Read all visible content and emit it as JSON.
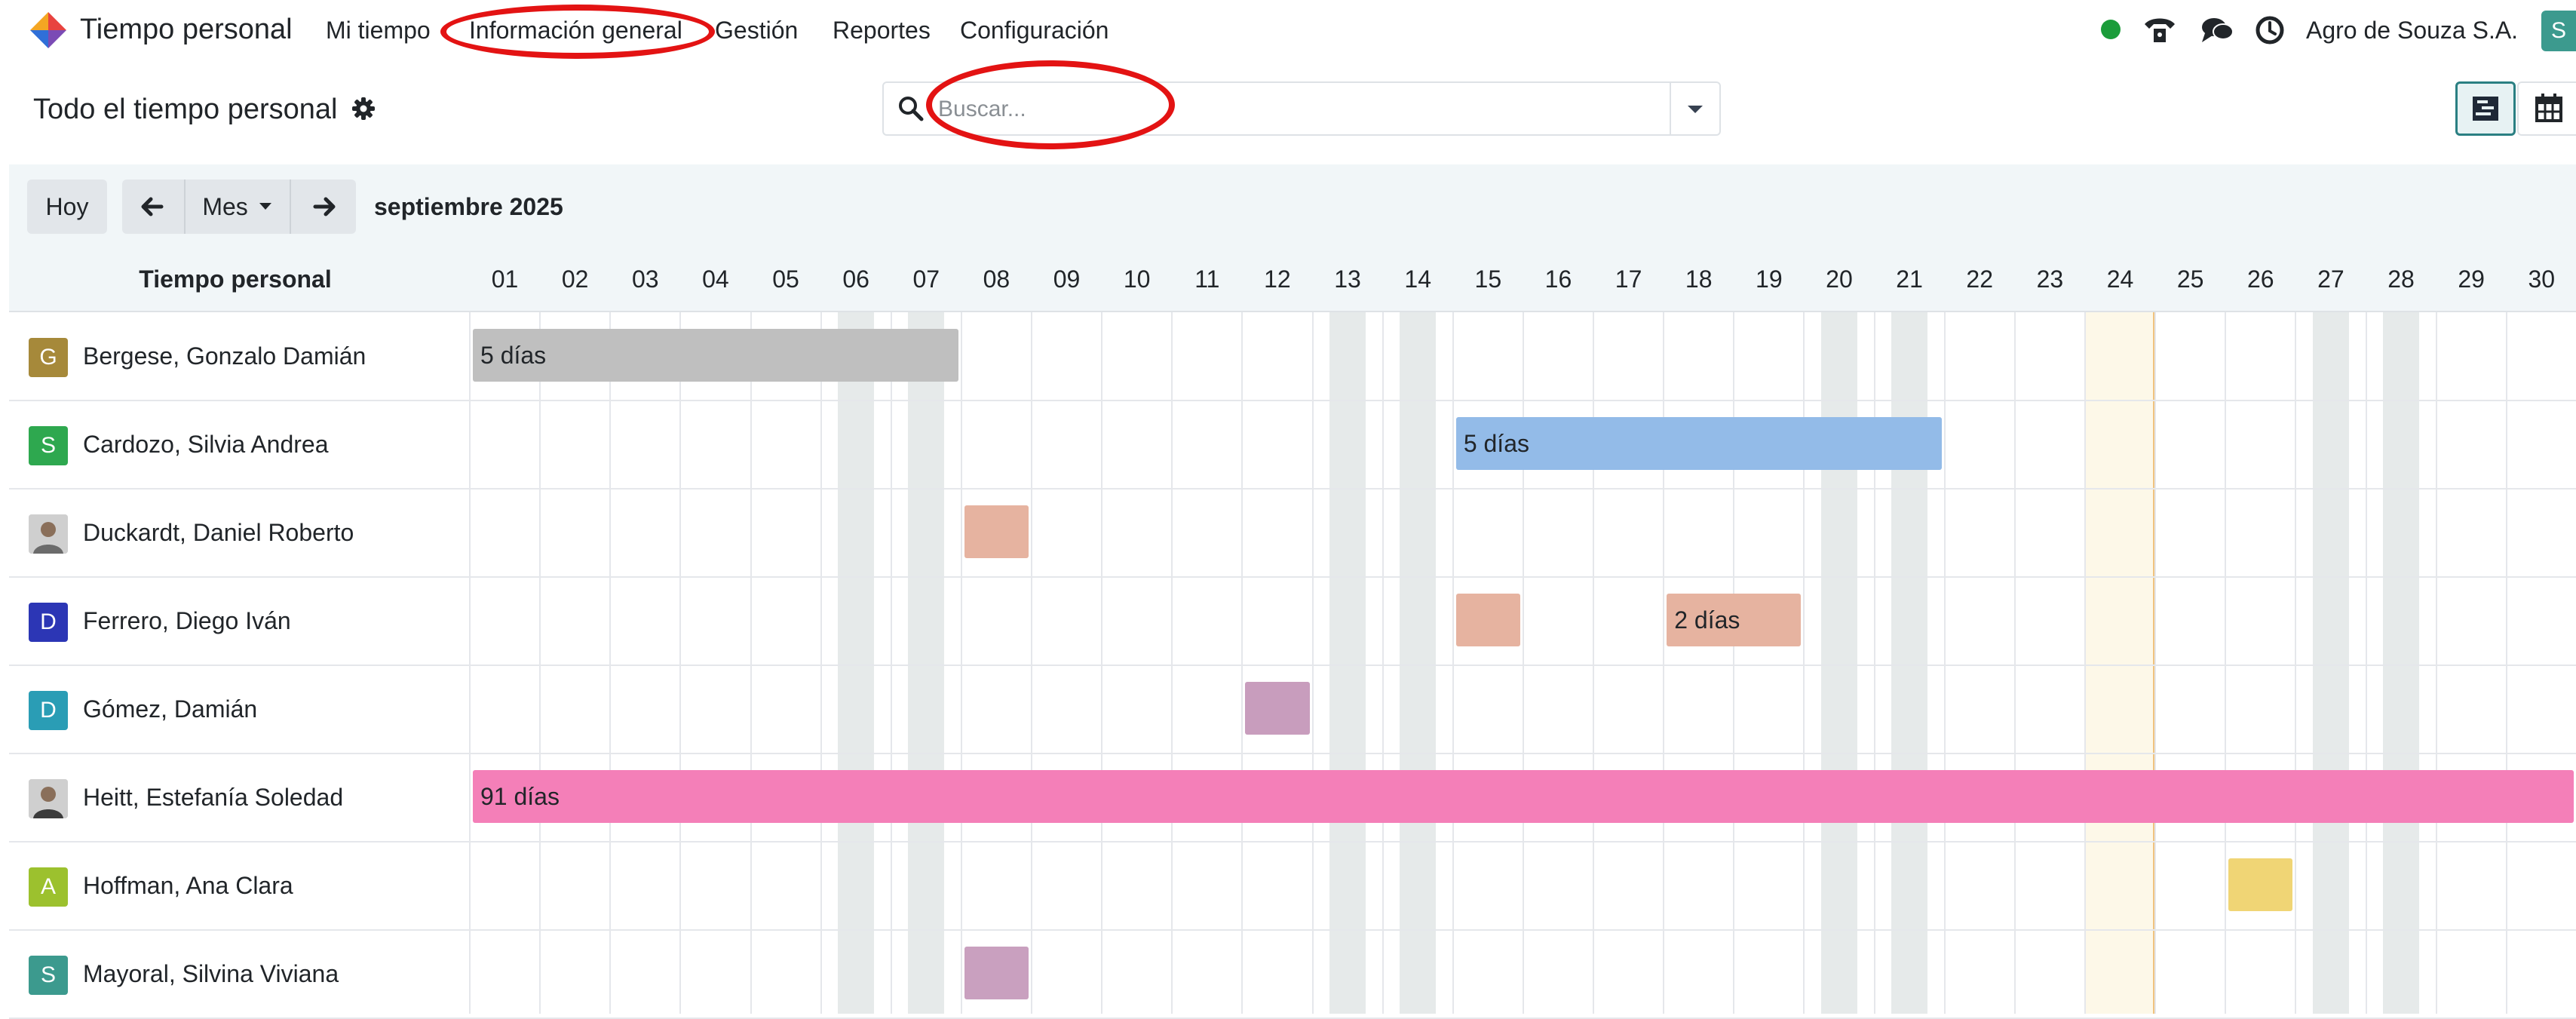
{
  "navbar": {
    "app_name": "Tiempo personal",
    "menu": [
      "Mi tiempo",
      "Información general",
      "Gestión",
      "Reportes",
      "Configuración"
    ],
    "company": "Agro de Souza S.A.",
    "user_initial": "S",
    "status_color": "#1b9c3a"
  },
  "control_panel": {
    "title": "Todo el tiempo personal",
    "search_placeholder": "Buscar..."
  },
  "toolbar": {
    "today_label": "Hoy",
    "scale_label": "Mes",
    "period": "septiembre 2025"
  },
  "gantt": {
    "header_title": "Tiempo personal",
    "days": [
      "01",
      "02",
      "03",
      "04",
      "05",
      "06",
      "07",
      "08",
      "09",
      "10",
      "11",
      "12",
      "13",
      "14",
      "15",
      "16",
      "17",
      "18",
      "19",
      "20",
      "21",
      "22",
      "23",
      "24",
      "25",
      "26",
      "27",
      "28",
      "29",
      "30"
    ],
    "weekend_days": [
      6,
      7,
      13,
      14,
      20,
      21,
      27,
      28
    ],
    "today": 24,
    "rows": [
      {
        "name": "Bergese, Gonzalo Damián",
        "initial": "G",
        "avatar_color": "#a6893a",
        "photo": false
      },
      {
        "name": "Cardozo, Silvia Andrea",
        "initial": "S",
        "avatar_color": "#2ea84f",
        "photo": false
      },
      {
        "name": "Duckardt, Daniel Roberto",
        "initial": "",
        "avatar_color": "#6b6b6b",
        "photo": true
      },
      {
        "name": "Ferrero, Diego Iván",
        "initial": "D",
        "avatar_color": "#2c36b5",
        "photo": false
      },
      {
        "name": "Gómez, Damián",
        "initial": "D",
        "avatar_color": "#2a9db5",
        "photo": false
      },
      {
        "name": "Heitt, Estefanía Soledad",
        "initial": "",
        "avatar_color": "#3b3b3b",
        "photo": true
      },
      {
        "name": "Hoffman, Ana Clara",
        "initial": "A",
        "avatar_color": "#9cc12e",
        "photo": false
      },
      {
        "name": "Mayoral, Silvina Viviana",
        "initial": "S",
        "avatar_color": "#3c9a8e",
        "photo": false
      }
    ],
    "leaves": [
      {
        "row": 0,
        "start": 1,
        "end": 7,
        "label": "5 días",
        "color": "#bfbfbf"
      },
      {
        "row": 1,
        "start": 15,
        "end": 21,
        "label": "5 días",
        "color": "#93bbe8"
      },
      {
        "row": 2,
        "start": 8,
        "end": 8,
        "label": "",
        "color": "#e6b3a0"
      },
      {
        "row": 3,
        "start": 15,
        "end": 15,
        "label": "",
        "color": "#e6b3a0"
      },
      {
        "row": 3,
        "start": 18,
        "end": 19,
        "label": "2 días",
        "color": "#e6b3a0"
      },
      {
        "row": 4,
        "start": 12,
        "end": 12,
        "label": "",
        "color": "#c89dbd"
      },
      {
        "row": 5,
        "start": 1,
        "end": 30,
        "label": "91 días",
        "color": "#f47fb8"
      },
      {
        "row": 6,
        "start": 26,
        "end": 26,
        "label": "",
        "color": "#f0d575"
      },
      {
        "row": 7,
        "start": 8,
        "end": 8,
        "label": "",
        "color": "#c9a0bf"
      }
    ]
  }
}
